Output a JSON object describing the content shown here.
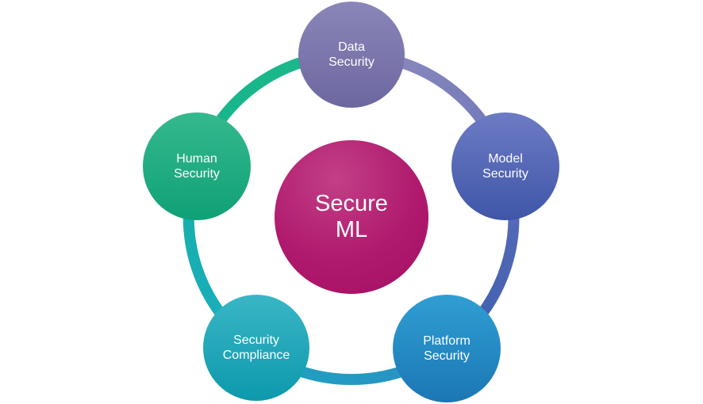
{
  "center": {
    "line1": "Secure",
    "line2": "ML"
  },
  "nodes": [
    {
      "id": "data",
      "line1": "Data",
      "line2": "Security"
    },
    {
      "id": "model",
      "line1": "Model",
      "line2": "Security"
    },
    {
      "id": "platform",
      "line1": "Platform",
      "line2": "Security"
    },
    {
      "id": "compliance",
      "line1": "Security",
      "line2": "Compliance"
    },
    {
      "id": "human",
      "line1": "Human",
      "line2": "Security"
    }
  ],
  "colors": {
    "center": "#b01a6e",
    "data": "#7772a8",
    "model": "#4f62b2",
    "platform": "#2487c2",
    "compliance": "#1aa7b8",
    "human": "#17a97f",
    "ring_data_model": "#8d8bbd",
    "ring_model_platform": "#4f62b2",
    "ring_platform_compliance": "#2a8fc6",
    "ring_compliance_human": "#1bb2bf",
    "ring_human_data": "#17b688"
  }
}
